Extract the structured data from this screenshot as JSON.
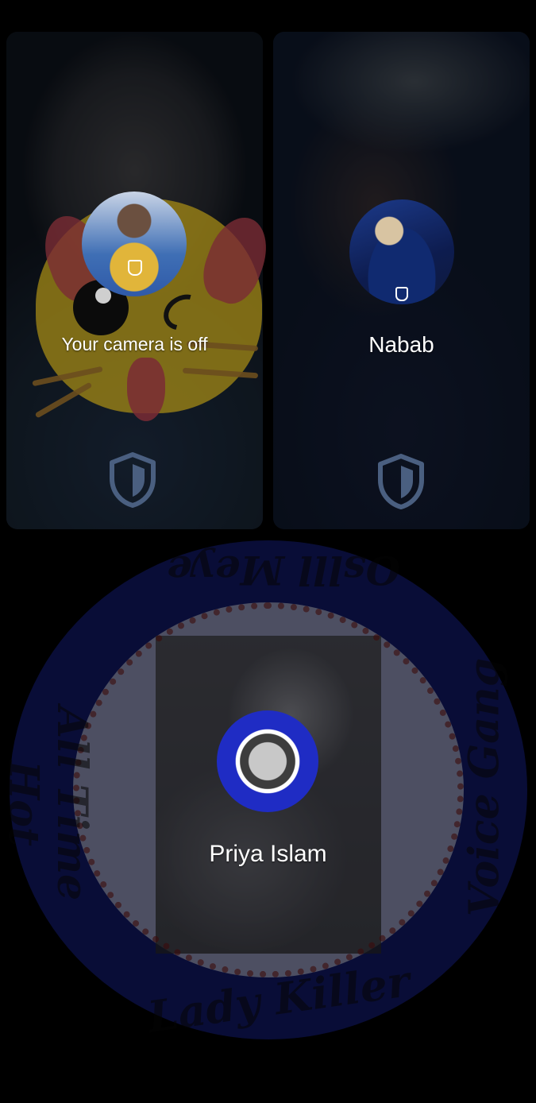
{
  "participants": [
    {
      "id": "self",
      "label": "Your camera is off",
      "avatar_icon": "cat-sticker-avatar",
      "verified_icon": "shield-icon"
    },
    {
      "id": "nabab",
      "label": "Nabab",
      "avatar_icon": "profile-photo-avatar",
      "verified_icon": "shield-icon"
    },
    {
      "id": "priya",
      "label": "Priya Islam",
      "avatar_icon": "emblem-avatar",
      "emblem_text": {
        "top": "Oslll Meye",
        "left": "All Time Hot",
        "right": "Voice Gang",
        "bottom": "Lady Killer"
      }
    }
  ],
  "colors": {
    "background": "#000000",
    "label": "#ffffff",
    "emblem_blue": "#1e2aa6",
    "shield_outline": "#4a5f80"
  }
}
